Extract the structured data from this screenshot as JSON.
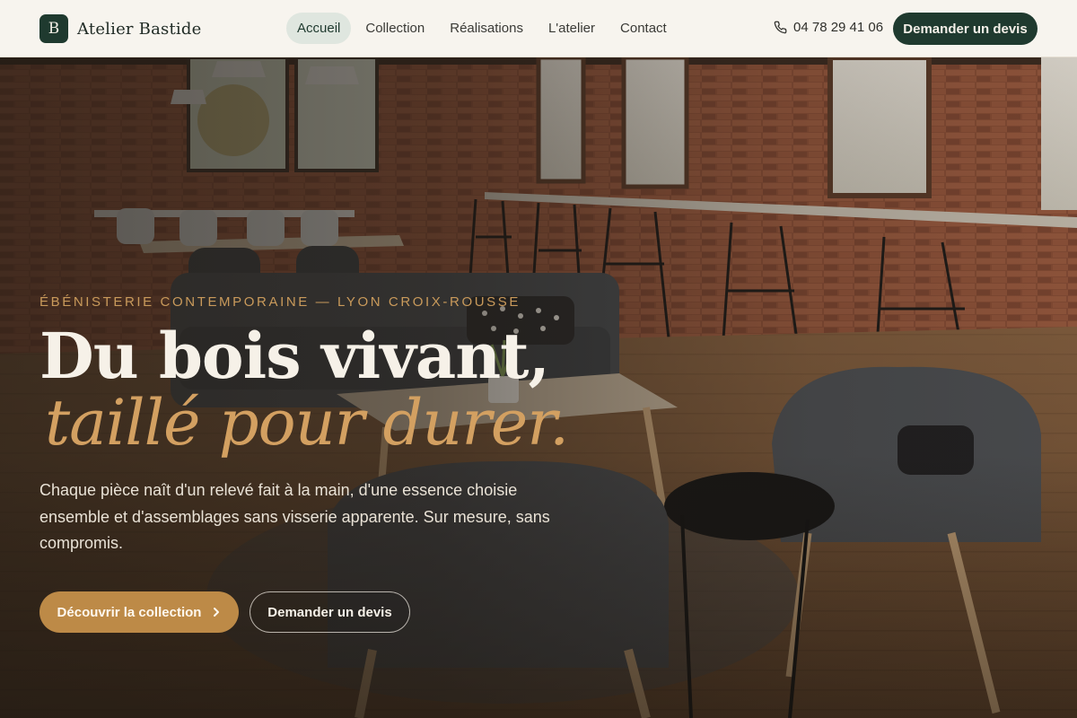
{
  "header": {
    "brand_letter": "B",
    "brand_name": "Atelier Bastide",
    "nav": [
      {
        "label": "Accueil",
        "active": true
      },
      {
        "label": "Collection"
      },
      {
        "label": "Réalisations"
      },
      {
        "label": "L'atelier"
      },
      {
        "label": "Contact"
      }
    ],
    "phone": "04 78 29 41 06",
    "cta_label": "Demander un devis"
  },
  "hero": {
    "eyebrow": "ÉBÉNISTERIE CONTEMPORAINE — LYON CROIX-ROUSSE",
    "title_line1": "Du bois vivant,",
    "title_line2": "taillé pour durer.",
    "lead": "Chaque pièce naît d'un relevé fait à la main, d'une essence choisie ensemble et d'assemblages sans visserie apparente. Sur mesure, sans compromis.",
    "primary_cta": "Découvrir la collection",
    "secondary_cta": "Demander un devis"
  },
  "colors": {
    "brand_green": "#1f3a2f",
    "accent_ochre": "#bd8a47",
    "header_bg": "#f7f4ee"
  },
  "icons": {
    "phone": "phone-icon",
    "chevron": "chevron-right-icon"
  }
}
